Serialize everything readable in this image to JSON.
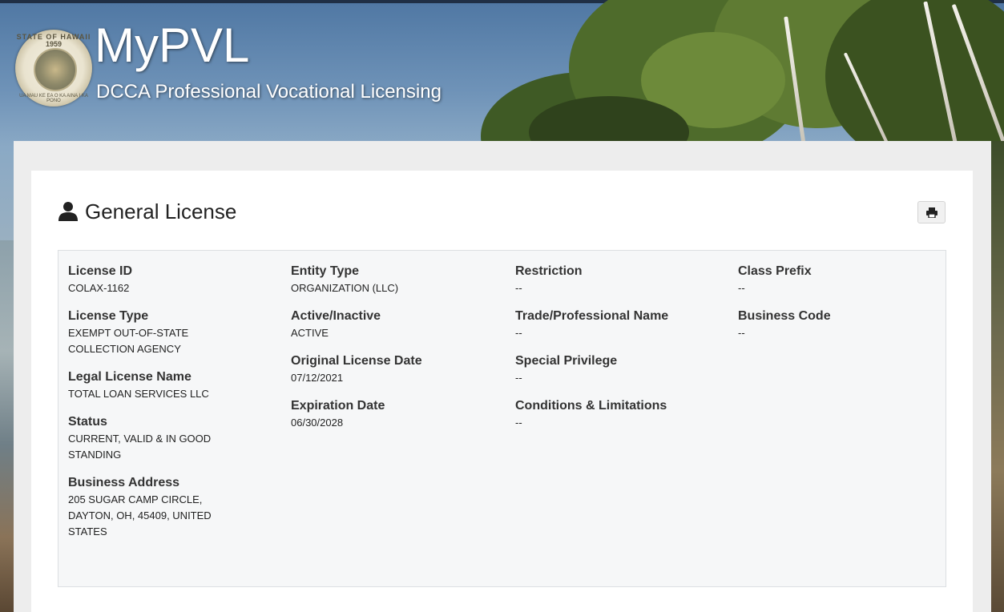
{
  "header": {
    "app_title": "MyPVL",
    "app_subtitle": "DCCA Professional Vocational Licensing",
    "seal": {
      "top_text": "STATE OF HAWAII",
      "year": "1959",
      "bottom_text": "UA MAU KE EA O KA AINA I KA PONO"
    }
  },
  "card": {
    "title": "General License",
    "title_icon": "user-icon",
    "print_icon": "print-icon"
  },
  "fields": {
    "col1": [
      {
        "label": "License ID",
        "value": "COLAX-1162"
      },
      {
        "label": "License Type",
        "value": "EXEMPT OUT-OF-STATE COLLECTION AGENCY"
      },
      {
        "label": "Legal License Name",
        "value": "TOTAL LOAN SERVICES LLC"
      },
      {
        "label": "Status",
        "value": "CURRENT, VALID & IN GOOD STANDING"
      },
      {
        "label": "Business Address",
        "value": "205 SUGAR CAMP CIRCLE, DAYTON, OH, 45409, UNITED STATES"
      }
    ],
    "col2": [
      {
        "label": "Entity Type",
        "value": "ORGANIZATION (LLC)"
      },
      {
        "label": "Active/Inactive",
        "value": "ACTIVE"
      },
      {
        "label": "Original License Date",
        "value": "07/12/2021"
      },
      {
        "label": "Expiration Date",
        "value": "06/30/2028"
      }
    ],
    "col3": [
      {
        "label": "Restriction",
        "value": "--"
      },
      {
        "label": "Trade/Professional Name",
        "value": "--"
      },
      {
        "label": "Special Privilege",
        "value": "--"
      },
      {
        "label": "Conditions & Limitations",
        "value": "--"
      }
    ],
    "col4": [
      {
        "label": "Class Prefix",
        "value": "--"
      },
      {
        "label": "Business Code",
        "value": "--"
      }
    ]
  },
  "colors": {
    "outer_panel": "#ededed",
    "card": "#ffffff",
    "info_box": "#f6f7f8",
    "info_border": "#dcdfe2",
    "title_text": "#ffffff"
  }
}
